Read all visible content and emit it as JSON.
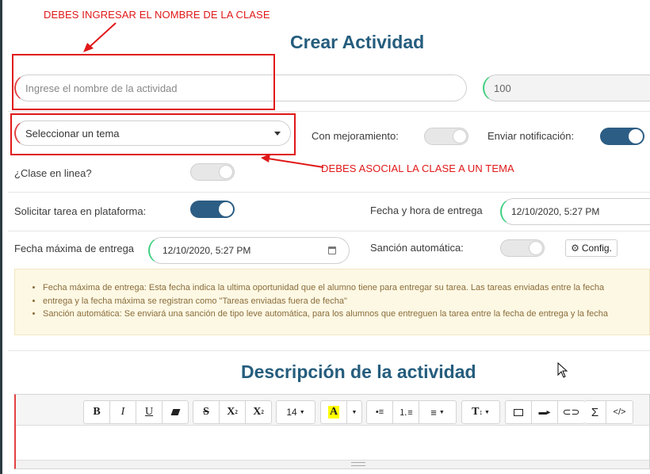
{
  "annotations": {
    "top": "DEBES INGRESAR EL NOMBRE DE LA CLASE",
    "middle": "DEBES ASOCIAL LA CLASE A UN TEMA"
  },
  "form": {
    "title": "Crear Actividad",
    "name_placeholder": "Ingrese el nombre de la actividad",
    "points_value": "100",
    "tema_select": "Seleccionar un tema",
    "con_mejoramiento_label": "Con mejoramiento:",
    "enviar_notificacion_label": "Enviar notificación:",
    "clase_en_linea_label": "¿Clase en linea?",
    "solicitar_tarea_label": "Solicitar tarea en plataforma:",
    "fecha_hora_entrega_label": "Fecha y hora de entrega",
    "fecha_hora_entrega_value": "12/10/2020, 5:27 PM",
    "fecha_maxima_label": "Fecha máxima de entrega",
    "fecha_maxima_value": "12/10/2020, 5:27 PM",
    "sancion_label": "Sanción automática:",
    "config_button": "Config.",
    "toggles": {
      "con_mejoramiento": false,
      "enviar_notificacion": true,
      "clase_en_linea": false,
      "solicitar_tarea": true,
      "sancion_automatica": false
    }
  },
  "notice": {
    "items": [
      "Fecha máxima de entrega: Esta fecha indica la ultima oportunidad que el alumno tiene para entregar su tarea. Las tareas enviadas entre la fecha",
      "entrega y la fecha máxima se registran como \"Tareas enviadas fuera de fecha\"",
      "Sanción automática: Se enviará una sanción de tipo leve automática, para los alumnos que entreguen la tarea entre la fecha de entrega y la fecha"
    ]
  },
  "description": {
    "title": "Descripción de la actividad"
  },
  "toolbar": {
    "bold": "B",
    "italic": "I",
    "underline": "U",
    "strike": "S",
    "superscript": "X",
    "subscript": "X",
    "font_size": "14",
    "font_color": "A",
    "textsize": "T",
    "sigma": "Σ",
    "code": "</>"
  },
  "colors": {
    "accent": "#255d7d",
    "toggle_on": "#2c5d84",
    "annotation": "#e01818",
    "notice_bg": "#fdf8e4"
  }
}
